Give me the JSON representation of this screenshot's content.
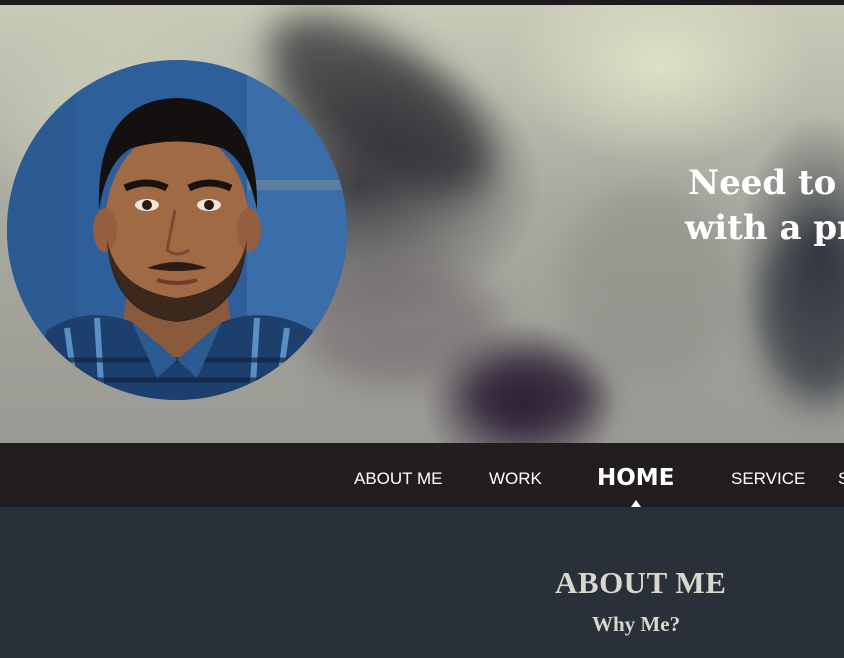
{
  "hero": {
    "headline_line1": "Need to fi",
    "headline_line2": "with a pr",
    "profile_photo": "profile-portrait"
  },
  "nav": {
    "items": [
      {
        "label": "ABOUT ME"
      },
      {
        "label": "WORK"
      },
      {
        "label": "HOME",
        "active": true
      },
      {
        "label": "SERVICE"
      },
      {
        "label": "S"
      }
    ]
  },
  "about": {
    "title": "ABOUT ME",
    "subtitle": "Why Me?"
  },
  "colors": {
    "navbar_bg": "#221e1f",
    "section_bg": "#2a3039",
    "heading_color": "#d9d8cc"
  }
}
